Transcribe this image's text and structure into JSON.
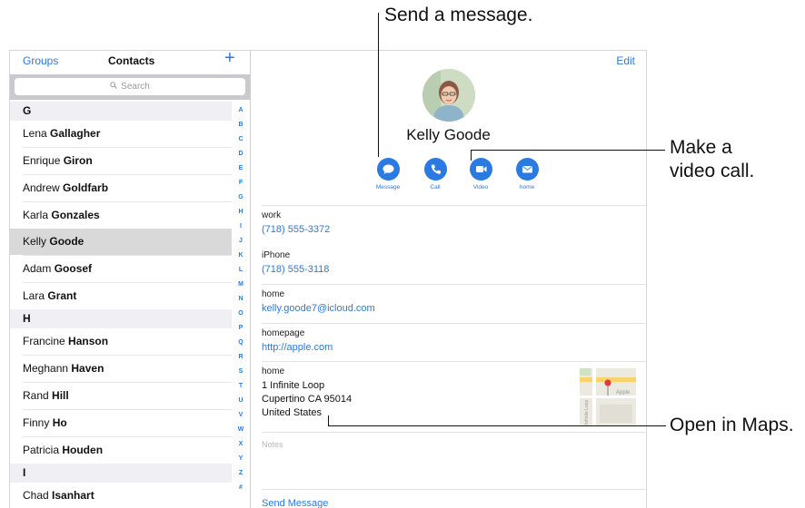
{
  "sidebar": {
    "groups_label": "Groups",
    "title": "Contacts",
    "add_label": "+",
    "search_placeholder": "Search"
  },
  "contacts": [
    {
      "type": "section",
      "letter": "G"
    },
    {
      "first": "Lena",
      "last": "Gallagher"
    },
    {
      "first": "Enrique",
      "last": "Giron"
    },
    {
      "first": "Andrew",
      "last": "Goldfarb"
    },
    {
      "first": "Karla",
      "last": "Gonzales"
    },
    {
      "first": "Kelly",
      "last": "Goode",
      "selected": true
    },
    {
      "first": "Adam",
      "last": "Goosef"
    },
    {
      "first": "Lara",
      "last": "Grant"
    },
    {
      "type": "section",
      "letter": "H"
    },
    {
      "first": "Francine",
      "last": "Hanson"
    },
    {
      "first": "Meghann",
      "last": "Haven"
    },
    {
      "first": "Rand",
      "last": "Hill"
    },
    {
      "first": "Finny",
      "last": "Ho"
    },
    {
      "first": "Patricia",
      "last": "Houden"
    },
    {
      "type": "section",
      "letter": "I"
    },
    {
      "first": "Chad",
      "last": "Isanhart"
    }
  ],
  "index_letters": [
    "A",
    "B",
    "C",
    "D",
    "E",
    "F",
    "G",
    "H",
    "I",
    "J",
    "K",
    "L",
    "M",
    "N",
    "O",
    "P",
    "Q",
    "R",
    "S",
    "T",
    "U",
    "V",
    "W",
    "X",
    "Y",
    "Z",
    "#"
  ],
  "detail": {
    "edit_label": "Edit",
    "name": "Kelly Goode",
    "actions": [
      {
        "label": "Message",
        "icon": "message-bubble-icon"
      },
      {
        "label": "Call",
        "icon": "phone-icon"
      },
      {
        "label": "Video",
        "icon": "video-camera-icon"
      },
      {
        "label": "home",
        "icon": "mail-envelope-icon"
      }
    ],
    "work_label": "work",
    "work_value": "(718) 555-3372",
    "iphone_label": "iPhone",
    "iphone_value": "(718) 555-3118",
    "email_label": "home",
    "email_value": "kelly.goode7@icloud.com",
    "homepage_label": "homepage",
    "homepage_value": "http://apple.com",
    "address_label": "home",
    "address_lines": [
      "1 Infinite Loop",
      "Cupertino CA 95014",
      "United States"
    ],
    "map_text": "Apple",
    "map_street": "Infinite Loop",
    "notes_placeholder": "Notes",
    "send_message": "Send Message"
  },
  "callouts": {
    "send": "Send a message.",
    "video_line1": "Make a",
    "video_line2": "video call.",
    "maps": "Open in Maps."
  },
  "colors": {
    "accent": "#2a7ae2",
    "selected_row": "#d9d9d9",
    "section_bg": "#efeff4"
  }
}
